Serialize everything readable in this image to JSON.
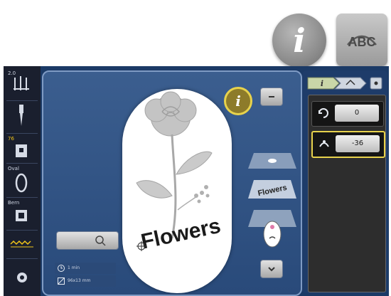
{
  "top_buttons": {
    "info_glyph": "i",
    "abc_label": "ABC"
  },
  "left_bar": {
    "needle_position_label": "2.0",
    "stitch_plate_label": "76",
    "hoop_label": "Oval",
    "bobbin_label": "Bern"
  },
  "canvas": {
    "info_glyph": "i",
    "design_text": "Flowers",
    "layer_label": "Flowers",
    "time_text": "1 min",
    "size_text": "96x13 mm"
  },
  "right_panel": {
    "tab_info": "i",
    "rows": [
      {
        "value": "0"
      },
      {
        "value": "-36"
      }
    ]
  },
  "colors": {
    "device_bg": "#1b3a66",
    "accent_yellow": "#e7d24c"
  }
}
